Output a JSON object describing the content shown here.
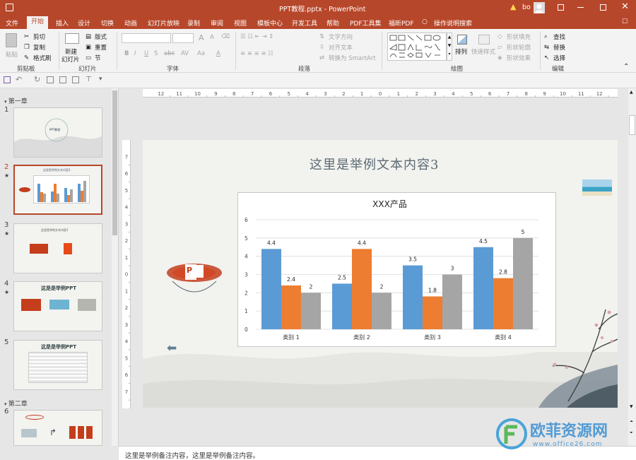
{
  "window": {
    "title": "PPT教程.pptx  -  PowerPoint",
    "user": "bo"
  },
  "menu": [
    "文件",
    "开始",
    "插入",
    "设计",
    "切换",
    "动画",
    "幻灯片放映",
    "录制",
    "审阅",
    "视图",
    "模板中心",
    "开发工具",
    "帮助",
    "PDF工具集",
    "福昕PDF",
    "操作说明搜索"
  ],
  "ribbon": {
    "clipboard": {
      "paste": "粘贴",
      "cut": "剪切",
      "copy": "复制",
      "format": "格式刷",
      "label": "剪贴板"
    },
    "slides": {
      "new": "新建",
      "new2": "幻灯片",
      "layout": "版式",
      "reset": "重置",
      "section": "节",
      "label": "幻灯片"
    },
    "font": {
      "label": "字体",
      "bold": "B",
      "italic": "I",
      "underline": "U",
      "strike": "S",
      "abc": "abc",
      "av": "AV",
      "aa": "Aa",
      "a_big": "A",
      "a_small": "A"
    },
    "paragraph": {
      "label": "段落",
      "dir": "文字方向",
      "align": "对齐文本",
      "smartart": "转换为 SmartArt"
    },
    "drawing": {
      "label": "绘图",
      "arrange": "排列",
      "quickstyle": "快速样式",
      "fill": "形状填充",
      "outline": "形状轮廓",
      "effect": "形状效果"
    },
    "editing": {
      "label": "编辑",
      "find": "查找",
      "replace": "替换",
      "select": "选择"
    }
  },
  "thumbnails": {
    "section1": "第一章",
    "section2": "第二章",
    "nums": [
      "1",
      "2",
      "3",
      "4",
      "5",
      "6"
    ],
    "t1_title": "PPT教程",
    "t2_title": "这里是举例文本内容3",
    "t3_title": "这里是举例文本内容1",
    "t4_title": "这是是举例PPT",
    "t5_title": "这是是举例PPT",
    "star": "★"
  },
  "ruler": {
    "h": [
      "12",
      "11",
      "10",
      "9",
      "8",
      "7",
      "6",
      "5",
      "4",
      "3",
      "2",
      "1",
      "0",
      "1",
      "2",
      "3",
      "4",
      "5",
      "6",
      "7",
      "8",
      "9",
      "10",
      "11",
      "12"
    ],
    "v": [
      "7",
      "6",
      "5",
      "4",
      "3",
      "2",
      "1",
      "0",
      "1",
      "2",
      "3",
      "4",
      "5",
      "6",
      "7"
    ]
  },
  "slide": {
    "title": "这里是举例文本内容3"
  },
  "chart_data": {
    "type": "bar",
    "title": "XXX产品",
    "categories": [
      "类别 1",
      "类别 2",
      "类别 3",
      "类别 4"
    ],
    "series": [
      {
        "values": [
          4.4,
          2.5,
          3.5,
          4.5
        ],
        "color": "#5b9bd5"
      },
      {
        "values": [
          2.4,
          4.4,
          1.8,
          2.8
        ],
        "color": "#ed7d31"
      },
      {
        "values": [
          2,
          2,
          3,
          5
        ],
        "color": "#a5a5a5"
      }
    ],
    "ylim": [
      0,
      6
    ],
    "yticks": [
      "0",
      "1",
      "2",
      "3",
      "4",
      "5",
      "6"
    ],
    "grid": true
  },
  "notes": {
    "text": "这里是举例备注内容，这里是举例备注内容。"
  },
  "watermark": {
    "brand": "欧菲资源网",
    "url": "www.office26.com"
  }
}
